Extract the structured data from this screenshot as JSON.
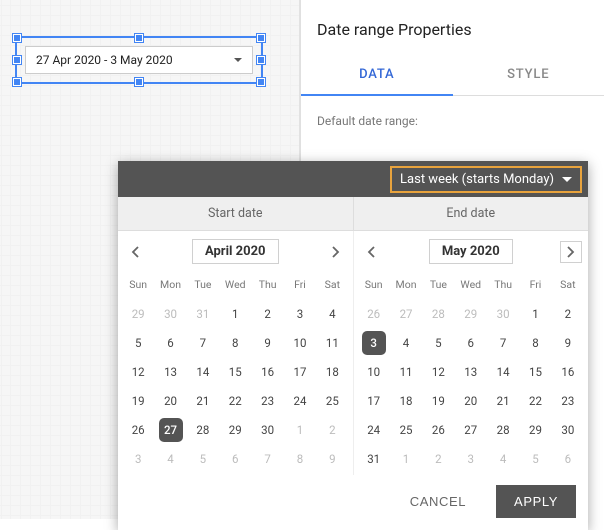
{
  "canvas": {
    "widget_label": "27 Apr 2020 - 3 May 2020"
  },
  "props": {
    "title": "Date range Properties",
    "tabs": {
      "data": "DATA",
      "style": "STYLE"
    },
    "section_label": "Default date range:"
  },
  "picker": {
    "preset_label": "Last week (starts Monday)",
    "tabs": {
      "start": "Start date",
      "end": "End date"
    },
    "actions": {
      "cancel": "CANCEL",
      "apply": "APPLY"
    },
    "dow": [
      "Sun",
      "Mon",
      "Tue",
      "Wed",
      "Thu",
      "Fri",
      "Sat"
    ],
    "months": [
      {
        "title": "April 2020",
        "selected_day": 27,
        "weeks": [
          [
            {
              "n": 29,
              "m": true
            },
            {
              "n": 30,
              "m": true
            },
            {
              "n": 31,
              "m": true
            },
            {
              "n": 1
            },
            {
              "n": 2
            },
            {
              "n": 3
            },
            {
              "n": 4
            }
          ],
          [
            {
              "n": 5
            },
            {
              "n": 6
            },
            {
              "n": 7
            },
            {
              "n": 8
            },
            {
              "n": 9
            },
            {
              "n": 10
            },
            {
              "n": 11
            }
          ],
          [
            {
              "n": 12
            },
            {
              "n": 13
            },
            {
              "n": 14
            },
            {
              "n": 15
            },
            {
              "n": 16
            },
            {
              "n": 17
            },
            {
              "n": 18
            }
          ],
          [
            {
              "n": 19
            },
            {
              "n": 20
            },
            {
              "n": 21
            },
            {
              "n": 22
            },
            {
              "n": 23
            },
            {
              "n": 24
            },
            {
              "n": 25
            }
          ],
          [
            {
              "n": 26
            },
            {
              "n": 27
            },
            {
              "n": 28
            },
            {
              "n": 29
            },
            {
              "n": 30
            },
            {
              "n": 1,
              "m": true
            },
            {
              "n": 2,
              "m": true
            }
          ],
          [
            {
              "n": 3,
              "m": true
            },
            {
              "n": 4,
              "m": true
            },
            {
              "n": 5,
              "m": true
            },
            {
              "n": 6,
              "m": true
            },
            {
              "n": 7,
              "m": true
            },
            {
              "n": 8,
              "m": true
            },
            {
              "n": 9,
              "m": true
            }
          ]
        ]
      },
      {
        "title": "May 2020",
        "selected_day": 3,
        "weeks": [
          [
            {
              "n": 26,
              "m": true
            },
            {
              "n": 27,
              "m": true
            },
            {
              "n": 28,
              "m": true
            },
            {
              "n": 29,
              "m": true
            },
            {
              "n": 30,
              "m": true
            },
            {
              "n": 1
            },
            {
              "n": 2
            }
          ],
          [
            {
              "n": 3
            },
            {
              "n": 4
            },
            {
              "n": 5
            },
            {
              "n": 6
            },
            {
              "n": 7
            },
            {
              "n": 8
            },
            {
              "n": 9
            }
          ],
          [
            {
              "n": 10
            },
            {
              "n": 11
            },
            {
              "n": 12
            },
            {
              "n": 13
            },
            {
              "n": 14
            },
            {
              "n": 15
            },
            {
              "n": 16
            }
          ],
          [
            {
              "n": 17
            },
            {
              "n": 18
            },
            {
              "n": 19
            },
            {
              "n": 20
            },
            {
              "n": 21
            },
            {
              "n": 22
            },
            {
              "n": 23
            }
          ],
          [
            {
              "n": 24
            },
            {
              "n": 25
            },
            {
              "n": 26
            },
            {
              "n": 27
            },
            {
              "n": 28
            },
            {
              "n": 29
            },
            {
              "n": 30
            }
          ],
          [
            {
              "n": 31
            },
            {
              "n": 1,
              "m": true
            },
            {
              "n": 2,
              "m": true
            },
            {
              "n": 3,
              "m": true
            },
            {
              "n": 4,
              "m": true
            },
            {
              "n": 5,
              "m": true
            },
            {
              "n": 6,
              "m": true
            }
          ]
        ]
      }
    ]
  }
}
